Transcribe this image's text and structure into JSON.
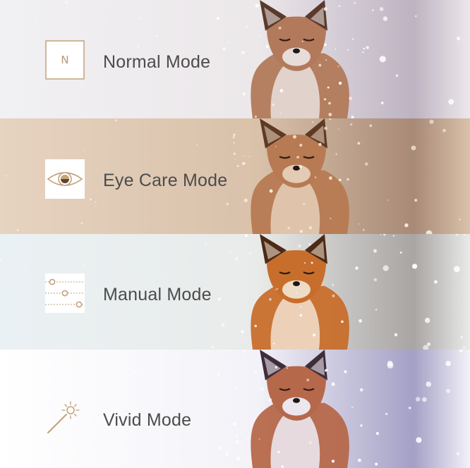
{
  "modes": [
    {
      "id": "normal",
      "label": "Normal Mode",
      "icon": "letter-n-icon",
      "icon_text": "N",
      "tint": {
        "bg_left": "#f1f0f3",
        "bg_mid": "#ece8ea",
        "bg_right": "#bdb3c2",
        "fox_body": "#b2795a",
        "fox_dark": "#5a3a2c",
        "fox_light": "#e6dcd8",
        "snow": "#ffffff"
      }
    },
    {
      "id": "eye-care",
      "label": "Eye Care Mode",
      "icon": "eye-icon",
      "tint": {
        "bg_left": "#e6d3c0",
        "bg_mid": "#d9c1aa",
        "bg_right": "#a88a76",
        "fox_body": "#b77a52",
        "fox_dark": "#5e3a24",
        "fox_light": "#e3cbb5",
        "snow": "#fbefe2"
      }
    },
    {
      "id": "manual",
      "label": "Manual Mode",
      "icon": "sliders-icon",
      "tint": {
        "bg_left": "#eaf1f4",
        "bg_mid": "#e9ebe9",
        "bg_right": "#a9a5a3",
        "fox_body": "#c86e2c",
        "fox_dark": "#4b2a16",
        "fox_light": "#efdcc6",
        "snow": "#ffffff"
      }
    },
    {
      "id": "vivid",
      "label": "Vivid Mode",
      "icon": "magic-wand-icon",
      "tint": {
        "bg_left": "#ffffff",
        "bg_mid": "#f3f2f8",
        "bg_right": "#a4a0c6",
        "fox_body": "#b6684a",
        "fox_dark": "#3f2d3a",
        "fox_light": "#ece6ee",
        "snow": "#ffffff"
      }
    }
  ],
  "accent_gold": "#c2a27c"
}
